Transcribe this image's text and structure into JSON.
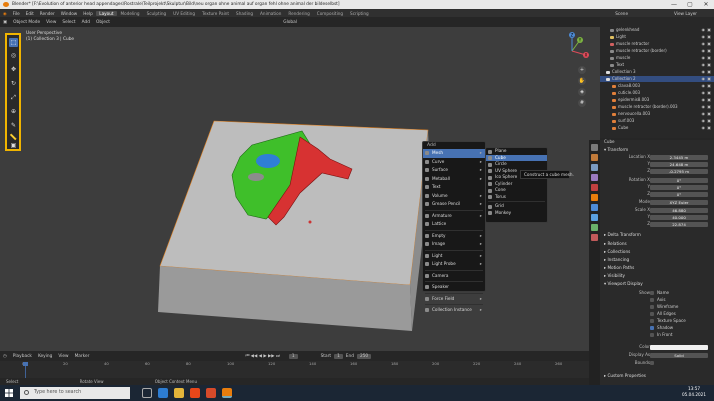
{
  "window": {
    "title": "Blender* [F:\\Evolution of anterior head appendages\\Rostrale\\Teilprojekt\\Skulptur\\Bild\\neu organ ohne animal auf organ fehl ohne animal der bildeselbst]",
    "controls": [
      "—",
      "▢",
      "✕"
    ]
  },
  "menubar": {
    "menus": [
      "File",
      "Edit",
      "Render",
      "Window",
      "Help"
    ],
    "workspaces": [
      "Layout",
      "Modeling",
      "Sculpting",
      "UV Editing",
      "Texture Paint",
      "Shading",
      "Animation",
      "Rendering",
      "Compositing",
      "Scripting"
    ],
    "scene_label": "Scene",
    "view_layer_label": "View Layer"
  },
  "viewport_header": {
    "mode": "Object Mode",
    "items": [
      "View",
      "Select",
      "Add",
      "Object"
    ],
    "shading": "Global"
  },
  "viewport_info": {
    "line1": "User Perspective",
    "line2": "(1) Collection 3 | Cube"
  },
  "gizmo": {
    "x": "X",
    "y": "Y",
    "z": "Z",
    "x_color": "#e04b5a",
    "y_color": "#7cb342",
    "z_color": "#4d8bd6"
  },
  "tools": [
    "select-box",
    "cursor",
    "move",
    "rotate",
    "scale",
    "transform",
    "annotate",
    "measure",
    "add-cube"
  ],
  "add_menu": {
    "title": "Add",
    "items": [
      {
        "label": "Mesh",
        "sub": true,
        "hl": true
      },
      {
        "label": "Curve",
        "sub": true
      },
      {
        "label": "Surface",
        "sub": true
      },
      {
        "label": "Metaball",
        "sub": true
      },
      {
        "label": "Text"
      },
      {
        "label": "Volume",
        "sub": true
      },
      {
        "label": "Grease Pencil",
        "sub": true
      },
      "-",
      {
        "label": "Armature",
        "sub": true
      },
      {
        "label": "Lattice"
      },
      "-",
      {
        "label": "Empty",
        "sub": true
      },
      {
        "label": "Image",
        "sub": true
      },
      "-",
      {
        "label": "Light",
        "sub": true
      },
      {
        "label": "Light Probe",
        "sub": true
      },
      "-",
      {
        "label": "Camera"
      },
      "-",
      {
        "label": "Speaker"
      },
      "-",
      {
        "label": "Force Field",
        "sub": true
      },
      "-",
      {
        "label": "Collection Instance",
        "sub": true
      }
    ]
  },
  "mesh_menu": {
    "items": [
      {
        "label": "Plane"
      },
      {
        "label": "Cube",
        "hl": true
      },
      {
        "label": "Circle"
      },
      {
        "label": "UV Sphere"
      },
      {
        "label": "Ico Sphere"
      },
      {
        "label": "Cylinder"
      },
      {
        "label": "Cone"
      },
      {
        "label": "Torus"
      },
      "-",
      {
        "label": "Grid"
      },
      {
        "label": "Monkey"
      }
    ]
  },
  "tooltip": "Construct a cube mesh.",
  "timeline": {
    "header": [
      "Playback",
      "Keying",
      "View",
      "Marker"
    ],
    "current_frame": "1",
    "start_label": "Start",
    "start": "1",
    "end_label": "End",
    "end": "250",
    "frames": [
      "0",
      "20",
      "40",
      "60",
      "80",
      "100",
      "120",
      "140",
      "160",
      "180",
      "200",
      "220",
      "240",
      "260"
    ]
  },
  "statusbar": {
    "select": "Select",
    "rotate": "Rotate View",
    "context": "Object Context Menu"
  },
  "taskbar": {
    "search_placeholder": "Type here to search",
    "time": "13:57",
    "date": "05.04.2021"
  },
  "outliner": {
    "rows": [
      {
        "label": "gelenkhead",
        "color": "#8a8a8a"
      },
      {
        "label": "Light",
        "color": "#e0c060"
      },
      {
        "label": "muscle retractor",
        "color": "#d06060"
      },
      {
        "label": "muscle retractor (border)",
        "color": "#8a8a8a"
      },
      {
        "label": "muscle",
        "color": "#8a8a8a"
      },
      {
        "label": "Text",
        "color": "#8a8a8a"
      },
      {
        "label": "Collection 3",
        "color": "#dddddd"
      },
      {
        "label": "Collection 2",
        "color": "#dddddd",
        "sel": true
      },
      {
        "label": "clava8.003",
        "color": "#e07f3a"
      },
      {
        "label": "cuticle.003",
        "color": "#e07f3a"
      },
      {
        "label": "epidermis8.003",
        "color": "#e07f3a"
      },
      {
        "label": "muscle retractor (border).003",
        "color": "#e07f3a"
      },
      {
        "label": "nervoucella.003",
        "color": "#e07f3a"
      },
      {
        "label": "surf.003",
        "color": "#e07f3a"
      },
      {
        "label": "Cube",
        "color": "#e07f3a"
      }
    ]
  },
  "properties": {
    "object": "Cube",
    "sections": {
      "transform": "Transform",
      "relations": "Relations",
      "collections": "Collections",
      "instancing": "Instancing",
      "motion_paths": "Motion Paths",
      "visibility": "Visibility",
      "viewport_display": "Viewport Display",
      "custom_properties": "Custom Properties",
      "delta": "Delta Transform"
    },
    "location": {
      "label": "Location X",
      "x": "2.3445 m",
      "y": "24.648 m",
      "z": "-0.2795 m"
    },
    "rotation": {
      "label": "Rotation X",
      "x": "0°",
      "y": "0°",
      "z": "0°"
    },
    "mode": {
      "label": "Mode",
      "value": "XYZ Euler"
    },
    "scale": {
      "label": "Scale X",
      "x": "46.880",
      "y": "40.000",
      "z": "22.874"
    },
    "axis_labels": [
      "Y",
      "Z"
    ],
    "show_label": "Show",
    "display": [
      {
        "label": "Name",
        "on": false
      },
      {
        "label": "Axis",
        "on": false
      },
      {
        "label": "Wireframe",
        "on": false
      },
      {
        "label": "All Edges",
        "on": false
      },
      {
        "label": "Texture Space",
        "on": false
      },
      {
        "label": "Shadow",
        "on": true
      },
      {
        "label": "In Front",
        "on": false
      }
    ],
    "color_label": "Color",
    "display_as_label": "Display As",
    "display_as": "Solid",
    "bounds_label": "Bounds"
  }
}
